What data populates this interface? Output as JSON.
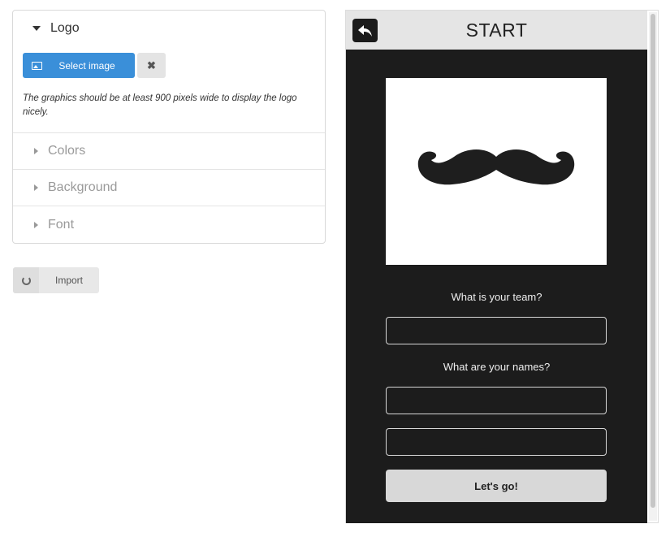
{
  "settings": {
    "sections": [
      {
        "label": "Logo",
        "open": true
      },
      {
        "label": "Colors",
        "open": false
      },
      {
        "label": "Background",
        "open": false
      },
      {
        "label": "Font",
        "open": false
      }
    ],
    "logo": {
      "select_label": "Select image",
      "clear_label": "✖",
      "hint": "The graphics should be at least 900 pixels wide to display the logo nicely."
    },
    "import_label": "Import"
  },
  "preview": {
    "title": "START",
    "logo_icon": "mustache-icon",
    "team_question": "What is your team?",
    "names_question": "What are your names?",
    "team_value": "",
    "name1_value": "",
    "name2_value": "",
    "go_label": "Let's go!"
  },
  "colors": {
    "accent": "#3a8fd9",
    "screen_bg": "#1c1c1c",
    "header_bg": "#e5e5e5"
  }
}
